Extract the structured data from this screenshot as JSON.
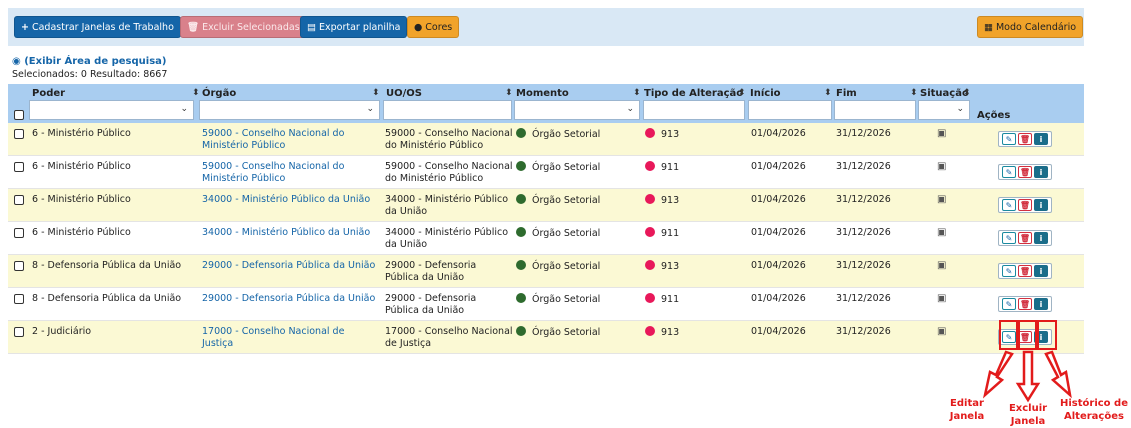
{
  "toolbar": {
    "add_label": "Cadastrar Janelas de Trabalho",
    "delete_label": "Excluir Selecionadas",
    "export_label": "Exportar planilha",
    "colors_label": "Cores",
    "calendar_label": "Modo Calendário"
  },
  "search": {
    "toggle_label": "(Exibir Área de pesquisa)",
    "counts_label": "Selecionados: 0 Resultado: 8667"
  },
  "columns": {
    "poder": "Poder",
    "orgao": "Órgão",
    "uo": "UO/OS",
    "momento": "Momento",
    "tipo": "Tipo de Alteração",
    "inicio": "Início",
    "fim": "Fim",
    "situacao": "Situação",
    "acoes": "Ações"
  },
  "rows": [
    {
      "poder": "6 - Ministério Público",
      "orgao": "59000 - Conselho Nacional do Ministério Público",
      "uo": "59000 - Conselho Nacional do Ministério Público",
      "momento": "Órgão Setorial",
      "tipo": "913",
      "inicio": "01/04/2026",
      "fim": "31/12/2026"
    },
    {
      "poder": "6 - Ministério Público",
      "orgao": "59000 - Conselho Nacional do Ministério Público",
      "uo": "59000 - Conselho Nacional do Ministério Público",
      "momento": "Órgão Setorial",
      "tipo": "911",
      "inicio": "01/04/2026",
      "fim": "31/12/2026"
    },
    {
      "poder": "6 - Ministério Público",
      "orgao": "34000 - Ministério Público da União",
      "uo": "34000 - Ministério Público da União",
      "momento": "Órgão Setorial",
      "tipo": "913",
      "inicio": "01/04/2026",
      "fim": "31/12/2026"
    },
    {
      "poder": "6 - Ministério Público",
      "orgao": "34000 - Ministério Público da União",
      "uo": "34000 - Ministério Público da União",
      "momento": "Órgão Setorial",
      "tipo": "911",
      "inicio": "01/04/2026",
      "fim": "31/12/2026"
    },
    {
      "poder": "8 - Defensoria Pública da União",
      "orgao": "29000 - Defensoria Pública da União",
      "uo": "29000 - Defensoria Pública da União",
      "momento": "Órgão Setorial",
      "tipo": "913",
      "inicio": "01/04/2026",
      "fim": "31/12/2026"
    },
    {
      "poder": "8 - Defensoria Pública da União",
      "orgao": "29000 - Defensoria Pública da União",
      "uo": "29000 - Defensoria Pública da União",
      "momento": "Órgão Setorial",
      "tipo": "911",
      "inicio": "01/04/2026",
      "fim": "31/12/2026"
    },
    {
      "poder": "2 - Judiciário",
      "orgao": "17000 - Conselho Nacional de Justiça",
      "uo": "17000 - Conselho Nacional de Justiça",
      "momento": "Órgão Setorial",
      "tipo": "913",
      "inicio": "01/04/2026",
      "fim": "31/12/2026"
    }
  ],
  "colors": {
    "momento_dot": "#2e6b2e",
    "tipo_dot": "#e8185a",
    "annotation": "#e21b1b"
  },
  "annotations": {
    "edit": "Editar Janela",
    "delete": "Excluir Janela",
    "history": "Histórico de Alterações"
  }
}
